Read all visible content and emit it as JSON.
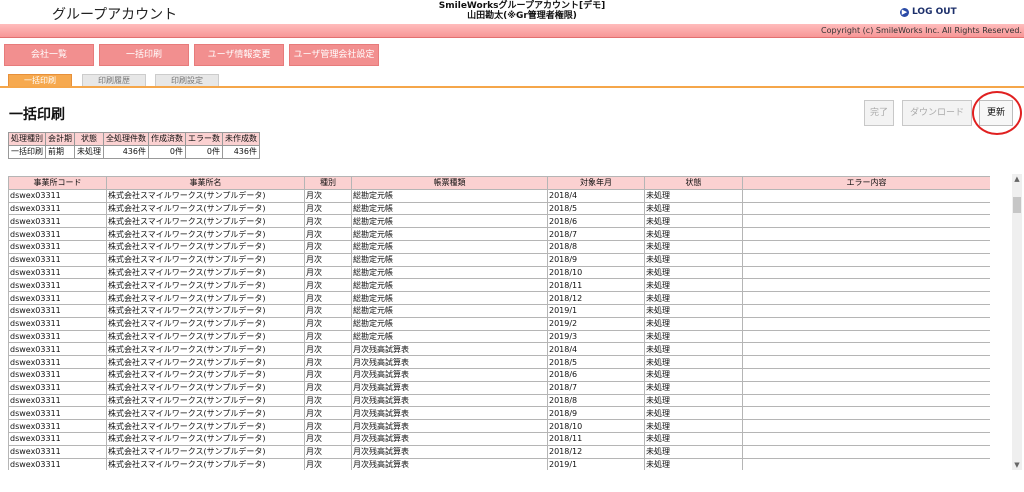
{
  "header": {
    "app_title": "グループアカウント",
    "demo_title_line1": "SmileWorksグループアカウント[デモ]",
    "demo_title_line2": "山田勘太(※Gr管理者権限)",
    "logout_label": "LOG OUT",
    "copyright": "Copyright (c) SmileWorks Inc. All Rights Reserved."
  },
  "menu": {
    "items": [
      "会社一覧",
      "一括印刷",
      "ユーザ情報変更",
      "ユーザ管理会社設定"
    ]
  },
  "tabs": [
    "一括印刷",
    "印刷履歴",
    "印刷設定"
  ],
  "page": {
    "title": "一括印刷",
    "buttons": {
      "complete": "完了",
      "download": "ダウンロード",
      "update": "更新"
    }
  },
  "summary": {
    "headers": [
      "処理種別",
      "会計期",
      "状態",
      "全処理件数",
      "作成済数",
      "エラー数",
      "未作成数"
    ],
    "row": [
      "一括印刷",
      "前期",
      "未処理",
      "436件",
      "0件",
      "0件",
      "436件"
    ]
  },
  "grid": {
    "headers": [
      "事業所コード",
      "事業所名",
      "種別",
      "帳票種類",
      "対象年月",
      "状態",
      "エラー内容"
    ],
    "rows": [
      [
        "dswex03311",
        "株式会社スマイルワークス(サンプルデータ)",
        "月次",
        "総勘定元帳",
        "2018/4",
        "未処理",
        ""
      ],
      [
        "dswex03311",
        "株式会社スマイルワークス(サンプルデータ)",
        "月次",
        "総勘定元帳",
        "2018/5",
        "未処理",
        ""
      ],
      [
        "dswex03311",
        "株式会社スマイルワークス(サンプルデータ)",
        "月次",
        "総勘定元帳",
        "2018/6",
        "未処理",
        ""
      ],
      [
        "dswex03311",
        "株式会社スマイルワークス(サンプルデータ)",
        "月次",
        "総勘定元帳",
        "2018/7",
        "未処理",
        ""
      ],
      [
        "dswex03311",
        "株式会社スマイルワークス(サンプルデータ)",
        "月次",
        "総勘定元帳",
        "2018/8",
        "未処理",
        ""
      ],
      [
        "dswex03311",
        "株式会社スマイルワークス(サンプルデータ)",
        "月次",
        "総勘定元帳",
        "2018/9",
        "未処理",
        ""
      ],
      [
        "dswex03311",
        "株式会社スマイルワークス(サンプルデータ)",
        "月次",
        "総勘定元帳",
        "2018/10",
        "未処理",
        ""
      ],
      [
        "dswex03311",
        "株式会社スマイルワークス(サンプルデータ)",
        "月次",
        "総勘定元帳",
        "2018/11",
        "未処理",
        ""
      ],
      [
        "dswex03311",
        "株式会社スマイルワークス(サンプルデータ)",
        "月次",
        "総勘定元帳",
        "2018/12",
        "未処理",
        ""
      ],
      [
        "dswex03311",
        "株式会社スマイルワークス(サンプルデータ)",
        "月次",
        "総勘定元帳",
        "2019/1",
        "未処理",
        ""
      ],
      [
        "dswex03311",
        "株式会社スマイルワークス(サンプルデータ)",
        "月次",
        "総勘定元帳",
        "2019/2",
        "未処理",
        ""
      ],
      [
        "dswex03311",
        "株式会社スマイルワークス(サンプルデータ)",
        "月次",
        "総勘定元帳",
        "2019/3",
        "未処理",
        ""
      ],
      [
        "dswex03311",
        "株式会社スマイルワークス(サンプルデータ)",
        "月次",
        "月次残高試算表",
        "2018/4",
        "未処理",
        ""
      ],
      [
        "dswex03311",
        "株式会社スマイルワークス(サンプルデータ)",
        "月次",
        "月次残高試算表",
        "2018/5",
        "未処理",
        ""
      ],
      [
        "dswex03311",
        "株式会社スマイルワークス(サンプルデータ)",
        "月次",
        "月次残高試算表",
        "2018/6",
        "未処理",
        ""
      ],
      [
        "dswex03311",
        "株式会社スマイルワークス(サンプルデータ)",
        "月次",
        "月次残高試算表",
        "2018/7",
        "未処理",
        ""
      ],
      [
        "dswex03311",
        "株式会社スマイルワークス(サンプルデータ)",
        "月次",
        "月次残高試算表",
        "2018/8",
        "未処理",
        ""
      ],
      [
        "dswex03311",
        "株式会社スマイルワークス(サンプルデータ)",
        "月次",
        "月次残高試算表",
        "2018/9",
        "未処理",
        ""
      ],
      [
        "dswex03311",
        "株式会社スマイルワークス(サンプルデータ)",
        "月次",
        "月次残高試算表",
        "2018/10",
        "未処理",
        ""
      ],
      [
        "dswex03311",
        "株式会社スマイルワークス(サンプルデータ)",
        "月次",
        "月次残高試算表",
        "2018/11",
        "未処理",
        ""
      ],
      [
        "dswex03311",
        "株式会社スマイルワークス(サンプルデータ)",
        "月次",
        "月次残高試算表",
        "2018/12",
        "未処理",
        ""
      ],
      [
        "dswex03311",
        "株式会社スマイルワークス(サンプルデータ)",
        "月次",
        "月次残高試算表",
        "2019/1",
        "未処理",
        ""
      ]
    ]
  }
}
